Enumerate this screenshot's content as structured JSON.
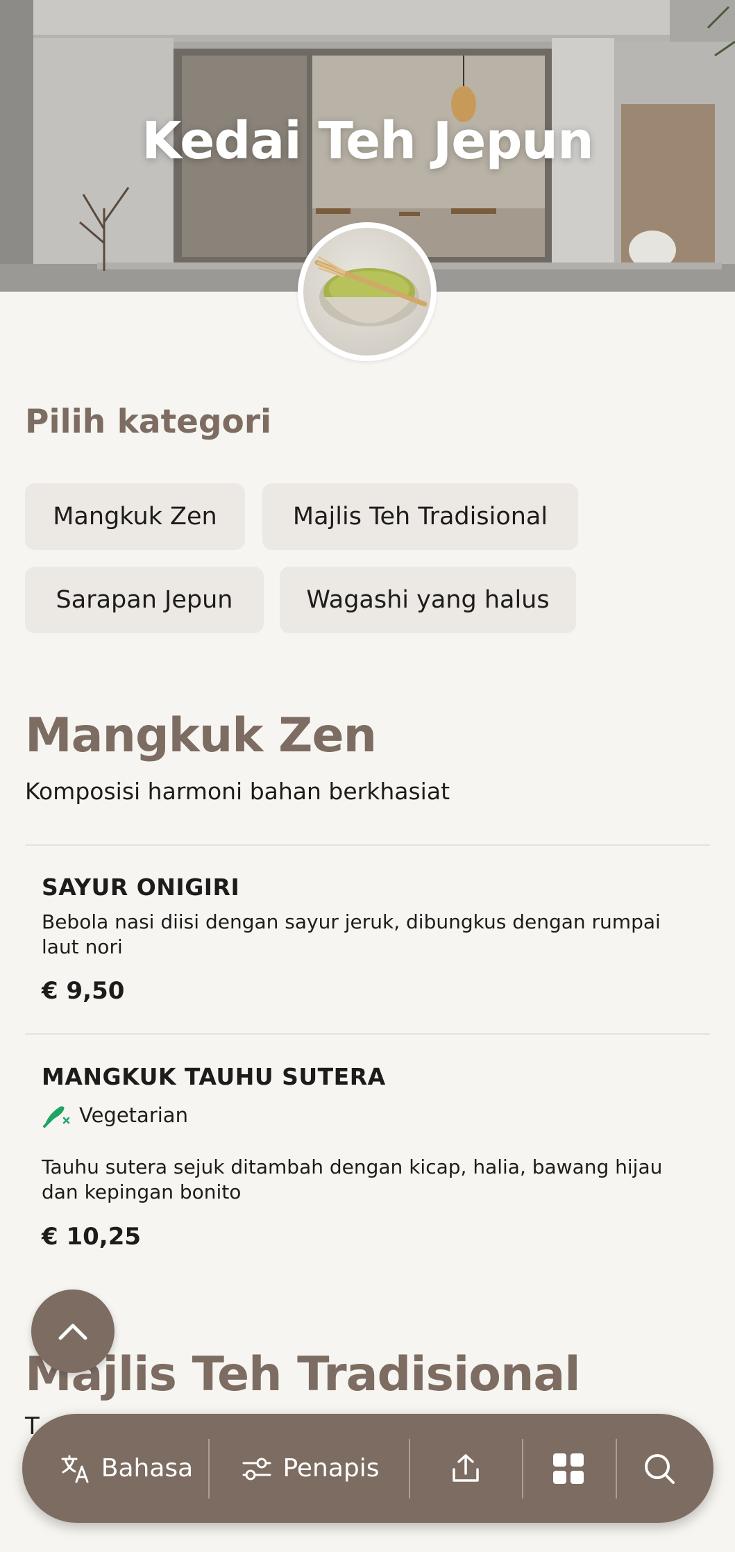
{
  "restaurant": {
    "name": "Kedai Teh Jepun"
  },
  "category_picker": {
    "label": "Pilih kategori",
    "chips": [
      "Mangkuk Zen",
      "Majlis Teh Tradisional",
      "Sarapan Jepun",
      "Wagashi yang halus"
    ]
  },
  "sections": [
    {
      "title": "Mangkuk Zen",
      "subtitle": "Komposisi harmoni bahan berkhasiat",
      "items": [
        {
          "name": "SAYUR ONIGIRI",
          "description": "Bebola nasi diisi dengan sayur jeruk, dibungkus dengan rumpai laut nori",
          "price": "€ 9,50"
        },
        {
          "name": "MANGKUK TAUHU SUTERA",
          "tag": "Vegetarian",
          "tag_icon": "vegetarian-leaf-icon",
          "description": "Tauhu sutera sejuk ditambah dengan kicap, halia, bawang hijau dan kepingan bonito",
          "price": "€ 10,25"
        }
      ]
    },
    {
      "title": "Majlis Teh Tradisional",
      "subtitle_peek": "T"
    }
  ],
  "bottom_bar": {
    "language_label": "Bahasa",
    "filter_label": "Penapis",
    "share_icon": "share-icon",
    "grid_icon": "grid-icon",
    "search_icon": "search-icon"
  },
  "colors": {
    "accent": "#7d6c61",
    "background": "#f6f5f1",
    "chip": "#ece9e4",
    "veg": "#1fa463"
  }
}
